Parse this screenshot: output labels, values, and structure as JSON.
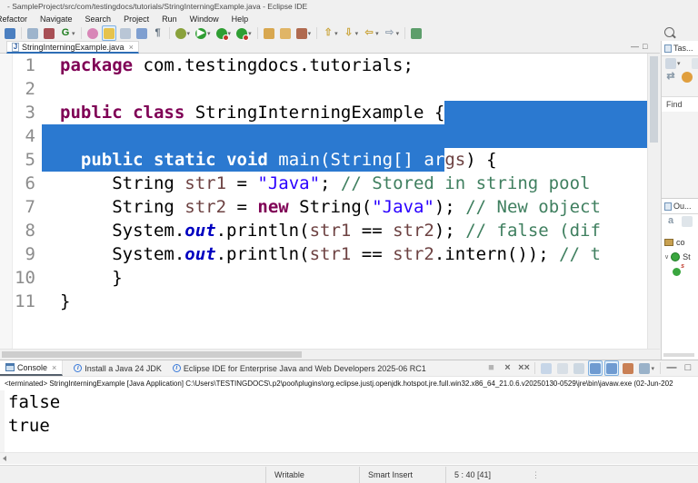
{
  "colors": {
    "selection": "#2b79d0",
    "keyword": "#7f0055",
    "string": "#2a00ff",
    "comment": "#3f7f5f",
    "variable": "#6d4242",
    "static_field": "#0000c0",
    "tab_underline": "#2d6db5"
  },
  "titlebar": {
    "title": "- SampleProject/src/com/testingdocs/tutorials/StringInterningExample.java - Eclipse IDE"
  },
  "menubar": {
    "items": [
      "Refactor",
      "Navigate",
      "Search",
      "Project",
      "Run",
      "Window",
      "Help"
    ]
  },
  "toolbar": {
    "icons": [
      {
        "name": "new-wizard",
        "shape": "box",
        "bg": "#4b7fc0"
      },
      {
        "sep": true
      },
      {
        "name": "save",
        "shape": "box",
        "bg": "#9db4cc"
      },
      {
        "name": "new-java-package",
        "shape": "box",
        "bg": "#a84f55"
      },
      {
        "name": "gradle-refresh",
        "shape": "text",
        "glyph": "G",
        "fg": "#1e7d1e",
        "dd": true
      },
      {
        "sep": true
      },
      {
        "name": "debug-flower",
        "shape": "circle",
        "bg": "#d886b7"
      },
      {
        "name": "format-brush",
        "shape": "box",
        "bg": "#e6c34d",
        "pressed": true
      },
      {
        "name": "skip-breakpoints",
        "shape": "box",
        "bg": "#b9c6d6"
      },
      {
        "name": "open-type",
        "shape": "box",
        "bg": "#7f9fd0"
      },
      {
        "name": "show-whitespace",
        "shape": "text",
        "glyph": "¶",
        "fg": "#5b6b7a"
      },
      {
        "sep": true
      },
      {
        "name": "external-tools",
        "shape": "circle",
        "bg": "#8aa23c",
        "dd": true
      },
      {
        "name": "run",
        "shape": "circle",
        "bg": "#2f9e33",
        "glyph": "▶",
        "fg": "#ffffff",
        "dd": true
      },
      {
        "name": "debug-run",
        "shape": "circle",
        "bg": "#2f9e33",
        "dot": "#c0392b",
        "dd": true
      },
      {
        "name": "coverage-run",
        "shape": "circle",
        "bg": "#2f9e33",
        "dot": "#c0392b",
        "dd": true
      },
      {
        "sep": true
      },
      {
        "name": "new-folder",
        "shape": "box",
        "bg": "#d8a74f"
      },
      {
        "name": "open-folder",
        "shape": "box",
        "bg": "#e0b566"
      },
      {
        "name": "launch-config",
        "shape": "box",
        "bg": "#b06a4f",
        "dd": true
      },
      {
        "sep": true
      },
      {
        "name": "previous-annotation",
        "shape": "text",
        "glyph": "⇧",
        "fg": "#caa53d",
        "dd": true
      },
      {
        "name": "next-annotation",
        "shape": "text",
        "glyph": "⇩",
        "fg": "#caa53d",
        "dd": true
      },
      {
        "name": "last-edit-location",
        "shape": "text",
        "glyph": "⇦",
        "fg": "#caa53d",
        "dd": true
      },
      {
        "name": "forward-history",
        "shape": "text",
        "glyph": "⇨",
        "fg": "#9aa7b5",
        "dd": true
      },
      {
        "sep": true
      },
      {
        "name": "open-perspective",
        "shape": "box",
        "bg": "#5d9e6b"
      }
    ]
  },
  "editor": {
    "tab": {
      "icon_letter": "J",
      "label": "StringInterningExample.java",
      "close_glyph": "×"
    },
    "window_controls": {
      "minimize_glyph": "—",
      "maximize_glyph": "□"
    },
    "lines": [
      {
        "num": "1",
        "tokens": [
          {
            "t": "package",
            "c": "k"
          },
          {
            "t": " com.testingdocs.tutorials;"
          }
        ]
      },
      {
        "num": "2",
        "tokens": []
      },
      {
        "num": "3",
        "tokens": [
          {
            "t": "public",
            "c": "k"
          },
          {
            "t": " "
          },
          {
            "t": "class",
            "c": "k"
          },
          {
            "t": " StringInterningExample {"
          }
        ],
        "fill_selection": true
      },
      {
        "num": "4",
        "tokens": [],
        "full_selection": true
      },
      {
        "num": "5",
        "sel_from_start": true,
        "tokens": [
          {
            "t": "  ",
            "sel": true
          },
          {
            "t": "public",
            "c": "k",
            "sel": true
          },
          {
            "t": " ",
            "sel": true
          },
          {
            "t": "static",
            "c": "k",
            "sel": true
          },
          {
            "t": " ",
            "sel": true
          },
          {
            "t": "void",
            "c": "k",
            "sel": true
          },
          {
            "t": " main(String[] ar",
            "sel": true
          },
          {
            "t": "gs",
            "c": "v"
          },
          {
            "t": ") {"
          }
        ]
      },
      {
        "num": "6",
        "tokens": [
          {
            "t": "     String "
          },
          {
            "t": "str1",
            "c": "v"
          },
          {
            "t": " = "
          },
          {
            "t": "\"Java\"",
            "c": "s"
          },
          {
            "t": "; "
          },
          {
            "t": "// Stored in string pool",
            "c": "c"
          }
        ]
      },
      {
        "num": "7",
        "tokens": [
          {
            "t": "     String "
          },
          {
            "t": "str2",
            "c": "v"
          },
          {
            "t": " = "
          },
          {
            "t": "new",
            "c": "k"
          },
          {
            "t": " String("
          },
          {
            "t": "\"Java\"",
            "c": "s"
          },
          {
            "t": "); "
          },
          {
            "t": "// New object",
            "c": "c"
          }
        ]
      },
      {
        "num": "8",
        "tokens": [
          {
            "t": "     System."
          },
          {
            "t": "out",
            "c": "f"
          },
          {
            "t": ".println("
          },
          {
            "t": "str1",
            "c": "v"
          },
          {
            "t": " == "
          },
          {
            "t": "str2",
            "c": "v"
          },
          {
            "t": "); "
          },
          {
            "t": "// false (dif",
            "c": "c"
          }
        ]
      },
      {
        "num": "9",
        "tokens": [
          {
            "t": "     System."
          },
          {
            "t": "out",
            "c": "f"
          },
          {
            "t": ".println("
          },
          {
            "t": "str1",
            "c": "v"
          },
          {
            "t": " == "
          },
          {
            "t": "str2",
            "c": "v"
          },
          {
            "t": ".intern()); "
          },
          {
            "t": "// t",
            "c": "c"
          }
        ]
      },
      {
        "num": "10",
        "tokens": [
          {
            "t": "     }"
          }
        ]
      },
      {
        "num": "11",
        "tokens": [
          {
            "t": "}"
          }
        ]
      }
    ]
  },
  "right_sidebar": {
    "task_panel": {
      "tab_label": "Tas...",
      "find_label": "Find",
      "toolbar_row1": [
        {
          "name": "new-task",
          "shape": "box",
          "bg": "#cfd8e2",
          "dd": true
        },
        {
          "sep": true
        },
        {
          "name": "categorized-view",
          "shape": "box",
          "bg": "#dfe5ea"
        }
      ],
      "toolbar_row2": [
        {
          "name": "link-with-editor",
          "shape": "text",
          "glyph": "⇄",
          "fg": "#8a9aa8"
        },
        {
          "name": "task-repository",
          "shape": "circle",
          "bg": "#e09f3e"
        },
        {
          "name": "task-list-presentation",
          "shape": "box",
          "bg": "#cfd8e2"
        }
      ]
    },
    "outline_panel": {
      "tab_label": "Ou...",
      "chevron_glyph": "∨",
      "static_decorator": "s",
      "toolbar_row1": [
        {
          "name": "sort-outline",
          "shape": "text",
          "glyph": "a",
          "fg": "#8a9aa8"
        },
        {
          "name": "hide-fields",
          "shape": "box",
          "bg": "#dfe5ea"
        },
        {
          "name": "hide-static-members",
          "shape": "text",
          "glyph": "s",
          "fg": "#8a9aa8"
        }
      ],
      "items": [
        {
          "type": "package",
          "label": "co",
          "indent": 0,
          "chevron": false
        },
        {
          "type": "class",
          "label": "St",
          "indent": 0,
          "chevron": true
        },
        {
          "type": "method",
          "label": "",
          "indent": 1,
          "chevron": false
        }
      ]
    }
  },
  "console": {
    "tab_label": "Console",
    "close_glyph": "×",
    "info_glyph": "i",
    "notifications": [
      {
        "label": "Install a Java 24 JDK"
      },
      {
        "label": "Eclipse IDE for Enterprise Java and Web Developers 2025-06 RC1"
      }
    ],
    "toolbar_icons": [
      {
        "name": "terminate",
        "shape": "text",
        "glyph": "■",
        "fg": "#b4b4b4"
      },
      {
        "name": "remove-launch",
        "shape": "text",
        "glyph": "×",
        "fg": "#6a6a6a"
      },
      {
        "name": "remove-all-launches",
        "shape": "text",
        "glyph": "××",
        "fg": "#6a6a6a"
      },
      {
        "sep": true
      },
      {
        "name": "clear-console",
        "shape": "box",
        "bg": "#c7d6e8"
      },
      {
        "name": "scroll-lock",
        "shape": "box",
        "bg": "#d8dfe6"
      },
      {
        "name": "word-wrap",
        "shape": "box",
        "bg": "#cdd8e2"
      },
      {
        "name": "show-stdout-on-change",
        "shape": "box",
        "bg": "#6f9bd1",
        "pressed": true
      },
      {
        "name": "show-stderr-on-change",
        "shape": "box",
        "bg": "#6f9bd1",
        "pressed": true
      },
      {
        "name": "pin-console",
        "shape": "box",
        "bg": "#c98055"
      },
      {
        "name": "open-console",
        "shape": "box",
        "bg": "#9ab2c9",
        "dd": true
      },
      {
        "sep": true
      },
      {
        "name": "minimize-console",
        "shape": "text",
        "glyph": "—",
        "fg": "#555555"
      },
      {
        "name": "maximize-console",
        "shape": "text",
        "glyph": "□",
        "fg": "#555555"
      }
    ],
    "title": "<terminated> StringInterningExample [Java Application] C:\\Users\\TESTINGDOCS\\.p2\\pool\\plugins\\org.eclipse.justj.openjdk.hotspot.jre.full.win32.x86_64_21.0.6.v20250130-0529\\jre\\bin\\javaw.exe (02-Jun-202",
    "output_lines": [
      "false",
      "true"
    ]
  },
  "statusbar": {
    "writable": "Writable",
    "insert_mode": "Smart Insert",
    "caret_position": "5 : 40 [41]",
    "overflow_glyph": "⋮"
  }
}
